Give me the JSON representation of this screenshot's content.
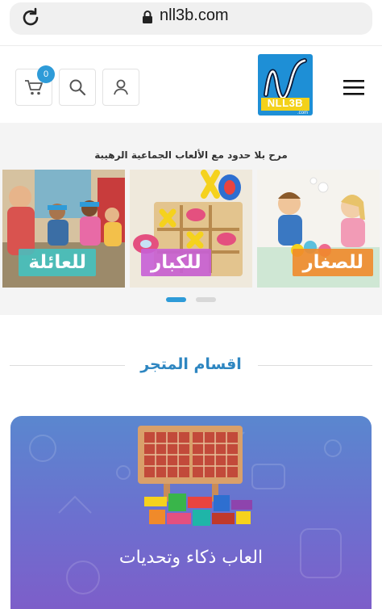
{
  "browser": {
    "url": "nll3b.com"
  },
  "header": {
    "cart_count": "0",
    "logo_text": "NLL3B",
    "logo_sub": ".com"
  },
  "slider": {
    "caption": "مرح بلا حدود مع الألعاب الجماعية الرهيبة",
    "slides": [
      {
        "label": "للعائلة",
        "label_color": "#3fc4c4"
      },
      {
        "label": "للكبار",
        "label_color": "#c75fd6"
      },
      {
        "label": "للصغار",
        "label_color": "#f08a2a"
      }
    ],
    "active_index": 0
  },
  "section": {
    "title": "اقسام المتجر"
  },
  "categories": [
    {
      "title": "العاب ذكاء وتحديات"
    }
  ],
  "colors": {
    "accent": "#2e86c1",
    "badge": "#2e9bd8"
  }
}
